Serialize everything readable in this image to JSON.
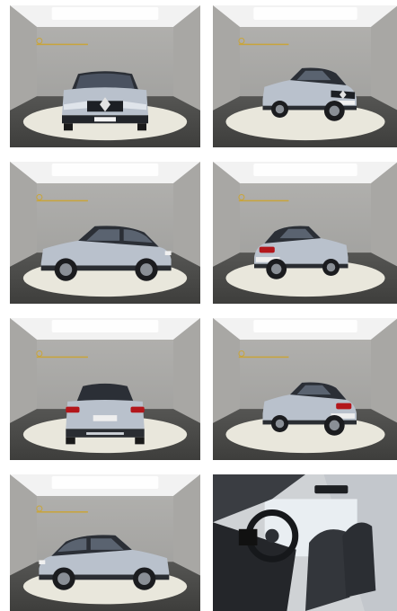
{
  "gallery": {
    "photos": [
      {
        "view": "front",
        "kind": "studio"
      },
      {
        "view": "front-right",
        "kind": "studio"
      },
      {
        "view": "side-right",
        "kind": "studio"
      },
      {
        "view": "rear-right",
        "kind": "studio"
      },
      {
        "view": "rear",
        "kind": "studio"
      },
      {
        "view": "rear-left",
        "kind": "studio"
      },
      {
        "view": "side-left",
        "kind": "studio"
      },
      {
        "view": "interior-front-seats",
        "kind": "interior"
      }
    ]
  },
  "colors": {
    "wall": "#9a9a98",
    "floor": "#3e3e3c",
    "turntable": "#e9e7dc",
    "ceiling": "#f2f2f2",
    "car_body": "#b9c1cc",
    "car_roof": "#2b2f36",
    "logo_gold": "#c9a53a",
    "tail_light": "#b3161b"
  },
  "icons": {
    "brand_logo": "diamond-logo-icon",
    "wall_logo": "gold-wall-logo-icon"
  }
}
